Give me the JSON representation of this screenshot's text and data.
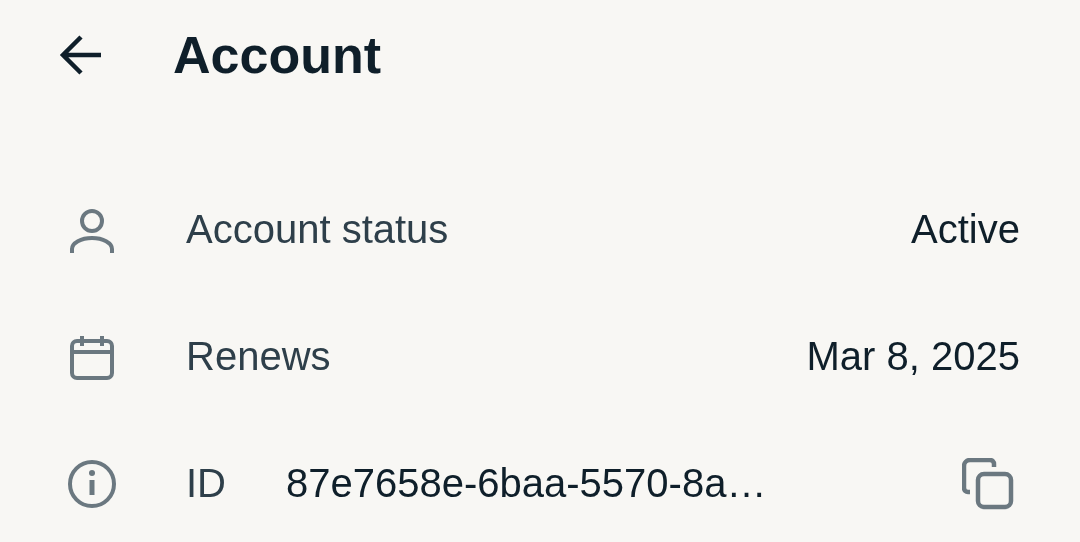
{
  "header": {
    "title": "Account"
  },
  "rows": [
    {
      "kind": "plain",
      "label": "Account status",
      "value": "Active"
    },
    {
      "kind": "plain",
      "label": "Renews",
      "value": "Mar 8, 2025"
    },
    {
      "kind": "copyable",
      "label": "ID",
      "value": "87e7658e-6baa-5570-8a…"
    }
  ]
}
